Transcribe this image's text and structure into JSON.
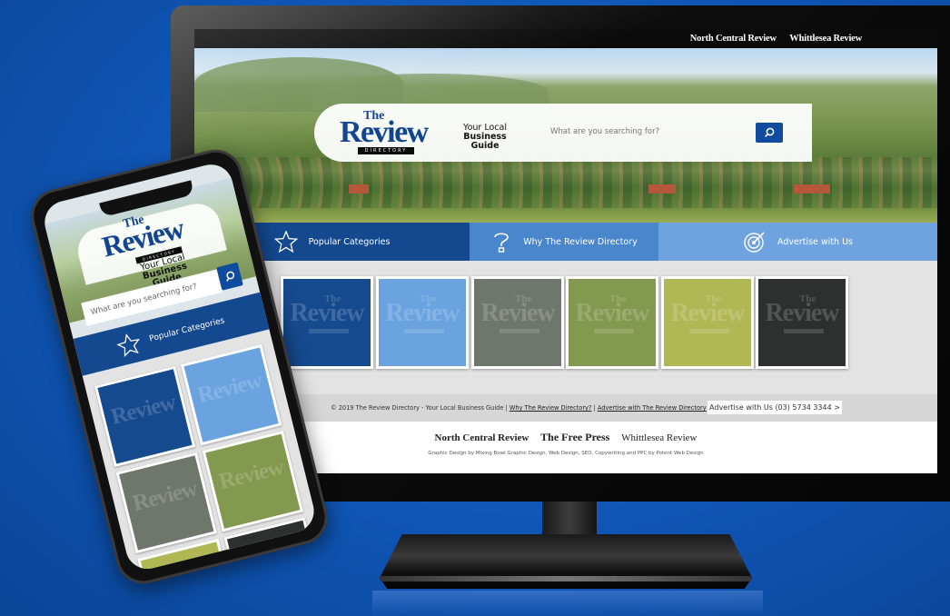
{
  "top_links": [
    "North Central Review",
    "Whittlesea Review"
  ],
  "logo": {
    "the": "The",
    "review": "Review",
    "directory": "DIRECTORY"
  },
  "tagline": {
    "line1": "Your Local",
    "line2": "Business Guide"
  },
  "search": {
    "placeholder": "What are you searching for?"
  },
  "nav": [
    {
      "label": "Popular Categories",
      "icon": "star-icon"
    },
    {
      "label": "Why The Review Directory",
      "icon": "question-icon"
    },
    {
      "label": "Advertise with Us",
      "icon": "target-icon"
    }
  ],
  "tile_colors": [
    "#164a8f",
    "#6aa3df",
    "#6f776c",
    "#83994f",
    "#b0b755",
    "#2e2f2f"
  ],
  "footer": {
    "copyright": "© 2019 The Review Directory - Your Local Business Guide",
    "sep": "|",
    "link1": "Why The Review Directory?",
    "link2": "Advertise with The Review Directory",
    "advertise_text": "Advertise with Us",
    "phone": "(03) 5734 3344",
    "chevron": ">",
    "publications": [
      "North Central Review",
      "The Free Press",
      "Whittlesea Review"
    ],
    "credits": "Graphic Design by Mixing Bowl Graphic Design. Web Design, SEO, Copywriting and PPC by Potent Web Design"
  },
  "phone": {
    "the": "The",
    "review": "Review",
    "directory": "DIRECTORY",
    "tag1": "Your Local",
    "tag2": "Business Guide",
    "search_placeholder": "What are you searching for?",
    "popular": "Popular Categories",
    "tile_colors": [
      "#164a8f",
      "#6aa3df",
      "#6f776c",
      "#83994f",
      "#b0b755",
      "#2e2f2f"
    ]
  },
  "colors": {
    "brand_blue": "#12458e",
    "background": "#0f55b5"
  }
}
